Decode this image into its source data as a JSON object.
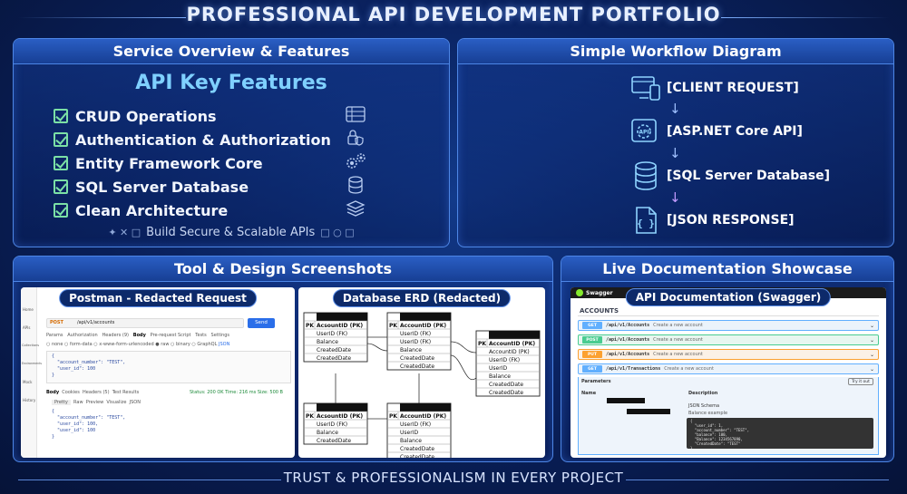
{
  "main_title": "PROFESSIONAL API DEVELOPMENT PORTFOLIO",
  "overview": {
    "header": "Service Overview & Features",
    "title": "API Key Features",
    "features": [
      {
        "label": "CRUD Operations",
        "icon": "table-icon"
      },
      {
        "label": "Authentication & Authorization",
        "icon": "lock-shield-icon"
      },
      {
        "label": "Entity Framework Core",
        "icon": "gears-icon"
      },
      {
        "label": "SQL Server Database",
        "icon": "database-icon"
      },
      {
        "label": "Clean Architecture",
        "icon": "layers-icon"
      }
    ],
    "tagline": "Build Secure & Scalable APIs"
  },
  "workflow": {
    "header": "Simple Workflow Diagram",
    "steps": [
      {
        "label": "[CLIENT REQUEST]",
        "icon": "devices-icon"
      },
      {
        "label": "[ASP.NET Core API]",
        "icon": "api-gear-icon"
      },
      {
        "label": "[SQL Server Database]",
        "icon": "database-icon"
      },
      {
        "label": "[JSON RESPONSE]",
        "icon": "json-file-icon"
      }
    ]
  },
  "tools": {
    "header": "Tool & Design Screenshots",
    "postman": {
      "label": "Postman - Redacted Request",
      "method": "POST",
      "url": "/api/v1/accounts",
      "send": "Send",
      "tabs": [
        "Params",
        "Authorization",
        "Headers (9)",
        "Body",
        "Pre-request Script",
        "Tests",
        "Settings"
      ],
      "body_types": [
        "none",
        "form-data",
        "x-www-form-urlencoded",
        "raw",
        "binary",
        "GraphQL",
        "JSON"
      ],
      "request_body": "{\n  \"account_number\": \"TEST\",\n  \"user_id\": 100\n}",
      "response_tabs": [
        "Body",
        "Cookies",
        "Headers (5)",
        "Test Results"
      ],
      "status": "Status: 200 OK   Time: 216 ms   Size: 500 B",
      "response_views": [
        "Pretty",
        "Raw",
        "Preview",
        "Visualize",
        "JSON"
      ],
      "response_body": "{\n  \"account_number\": \"TEST\",\n  \"user_id\": 100,\n  \"user_id\": 100\n}",
      "sidebar": [
        "Home",
        "APIs",
        "Collections",
        "Environments",
        "Mock",
        "History"
      ]
    },
    "erd": {
      "label": "Database ERD (Redacted)",
      "tables": [
        {
          "rows": [
            "AcsountID (PK)",
            "UserID (FK)",
            "Balance",
            "CreatedDate",
            "CreatedDate"
          ]
        },
        {
          "rows": [
            "AccountID (PK)",
            "UserID (FK)",
            "UserID (FK)",
            "Balance",
            "CreatedDate",
            "CreatedDate"
          ]
        },
        {
          "rows": [
            "AccountID (PK)",
            "AccountID (PK)",
            "UserID (FK)",
            "UserID",
            "Balance",
            "CreatedDate",
            "CreatedDate"
          ]
        },
        {
          "rows": [
            "AcsountID (PK)",
            "UserID (FK)",
            "Balance",
            "CreatedDate"
          ]
        },
        {
          "rows": [
            "AccountID (PK)",
            "UserID (FK)",
            "UserID",
            "Balance",
            "CreatedDate",
            "CreatedDate"
          ]
        }
      ],
      "pk": "PK"
    }
  },
  "docs": {
    "header": "Live Documentation Showcase",
    "swagger": {
      "label": "API Documentation (Swagger)",
      "brand": "Swagger",
      "section": "ACCOUNTS",
      "endpoints": [
        {
          "method": "GET",
          "path": "/api/v1/Accounts",
          "desc": "Create a new account",
          "color": "#61affe"
        },
        {
          "method": "POST",
          "path": "/api/v1/Accounts",
          "desc": "Create a new account",
          "color": "#49cc90"
        },
        {
          "method": "PUT",
          "path": "/api/v1/Accounts",
          "desc": "Create a new account",
          "color": "#fca130"
        },
        {
          "method": "GET",
          "path": "/api/v1/Transactions",
          "desc": "Create a new account",
          "color": "#61affe"
        }
      ],
      "params_label": "Parameters",
      "try_label": "Try it out",
      "name_col": "Name",
      "desc_col": "Description",
      "schema_label": "JSON Schema",
      "example_label": "Balance example",
      "json_sample": "{\n  \"user_id\": 1,\n  \"account_number\": \"TEST\",\n  \"balance\": 100,\n  \"Balance\": 1234567890,\n  \"CreatedDate\": \"TEST\"\n}"
    }
  },
  "footer": "TRUST & PROFESSIONALISM IN EVERY PROJECT",
  "colors": {
    "accent": "#7fd0ff",
    "check": "#7be0a6",
    "panel_border": "#4d86e6",
    "swagger_green": "#85ea2d"
  }
}
